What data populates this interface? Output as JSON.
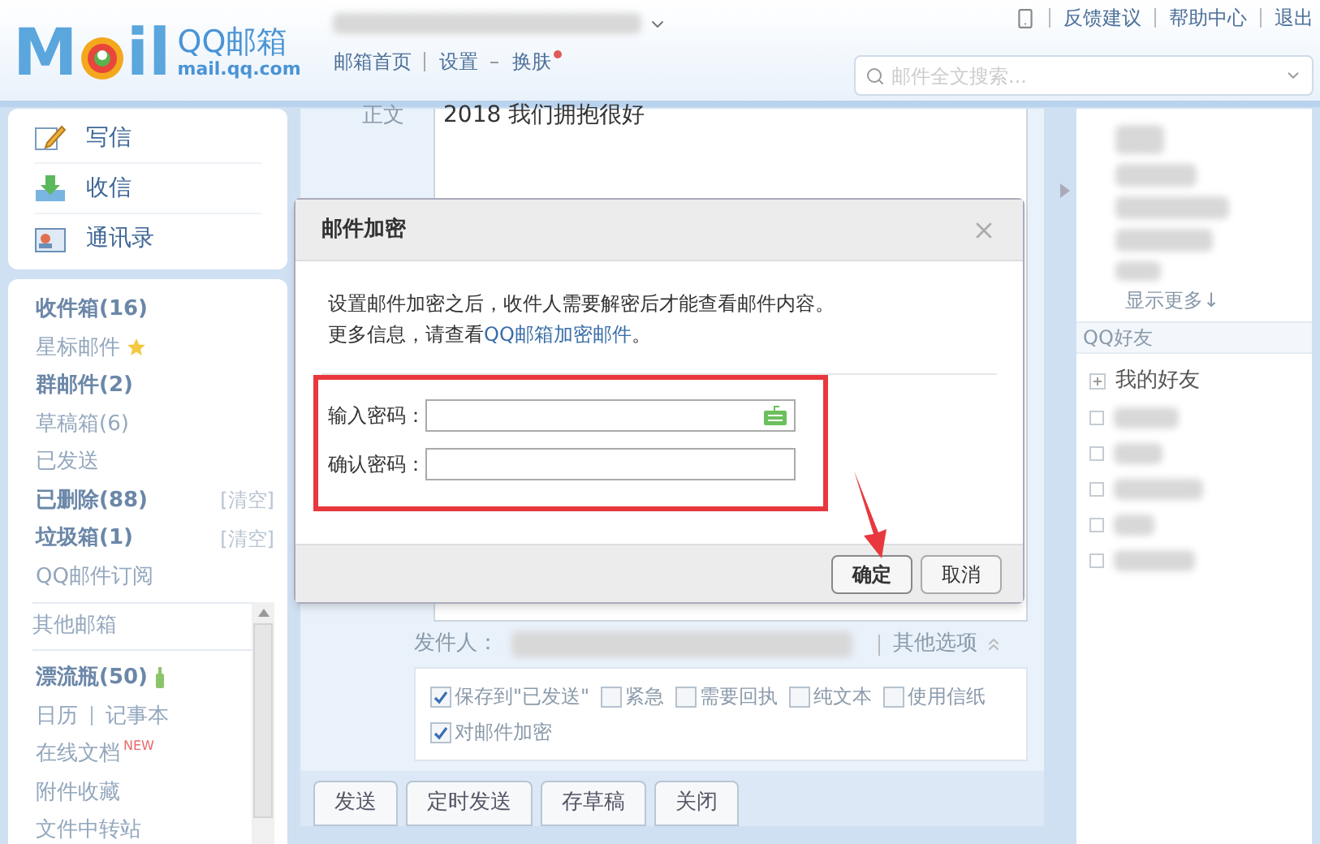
{
  "header": {
    "logo_letters": [
      "M",
      "il"
    ],
    "logo_text": "QQ邮箱",
    "logo_domain": "mail.qq.com",
    "nav_links": [
      "邮箱首页",
      "设置",
      "换肤"
    ],
    "top_links": [
      "反馈建议",
      "帮助中心",
      "退出"
    ],
    "search": {
      "placeholder": "邮件全文搜索..."
    }
  },
  "sidebar": {
    "actions": [
      {
        "label": "写信",
        "kind": "write"
      },
      {
        "label": "收信",
        "kind": "receive"
      },
      {
        "label": "通讯录",
        "kind": "contacts"
      }
    ],
    "folders": [
      {
        "label": "收件箱(16)",
        "bold": true
      },
      {
        "label": "星标邮件",
        "bold": false,
        "kind": "star"
      },
      {
        "label": "群邮件(2)",
        "bold": true
      },
      {
        "label": "草稿箱(6)",
        "bold": false
      },
      {
        "label": "已发送",
        "bold": false
      },
      {
        "label": "已删除(88)",
        "bold": true,
        "action": "[清空]"
      },
      {
        "label": "垃圾箱(1)",
        "bold": true,
        "action": "[清空]"
      },
      {
        "label": "QQ邮件订阅",
        "bold": false
      }
    ],
    "other_header": "其他邮箱",
    "tools": [
      {
        "label": "漂流瓶(50)",
        "bold": true,
        "kind": "bottle"
      },
      {
        "kind": "pair",
        "labels": [
          "日历",
          "记事本"
        ]
      },
      {
        "label": "在线文档",
        "badge": "NEW",
        "bold": false
      },
      {
        "label": "附件收藏",
        "bold": false
      },
      {
        "label": "文件中转站",
        "bold": false
      }
    ]
  },
  "compose": {
    "body_label": "正文",
    "body_text": "2018 我们拥抱很好",
    "sender_label": "发件人：",
    "other_options": "其他选项",
    "options": [
      {
        "label": "保存到\"已发送\"",
        "checked": true
      },
      {
        "label": "紧急",
        "checked": false
      },
      {
        "label": "需要回执",
        "checked": false
      },
      {
        "label": "纯文本",
        "checked": false
      },
      {
        "label": "使用信纸",
        "checked": false
      },
      {
        "label": "对邮件加密",
        "checked": true
      }
    ],
    "buttons": [
      "发送",
      "定时发送",
      "存草稿",
      "关闭"
    ]
  },
  "right_panel": {
    "show_more": "显示更多↓",
    "friends_header": "QQ好友",
    "groups": [
      {
        "label": "我的好友",
        "expanded": false
      }
    ]
  },
  "dialog": {
    "title": "邮件加密",
    "line1": "设置邮件加密之后，收件人需要解密后才能查看邮件内容。",
    "line2_before": "更多信息，请查看",
    "line2_link": "QQ邮箱加密邮件",
    "line2_after": "。",
    "fields": [
      {
        "label": "输入密码：",
        "kind": "keyboard"
      },
      {
        "label": "确认密码：",
        "kind": "plain"
      }
    ],
    "buttons": [
      {
        "label": "确定",
        "kind": "primary"
      },
      {
        "label": "取消",
        "kind": "secondary"
      }
    ]
  }
}
